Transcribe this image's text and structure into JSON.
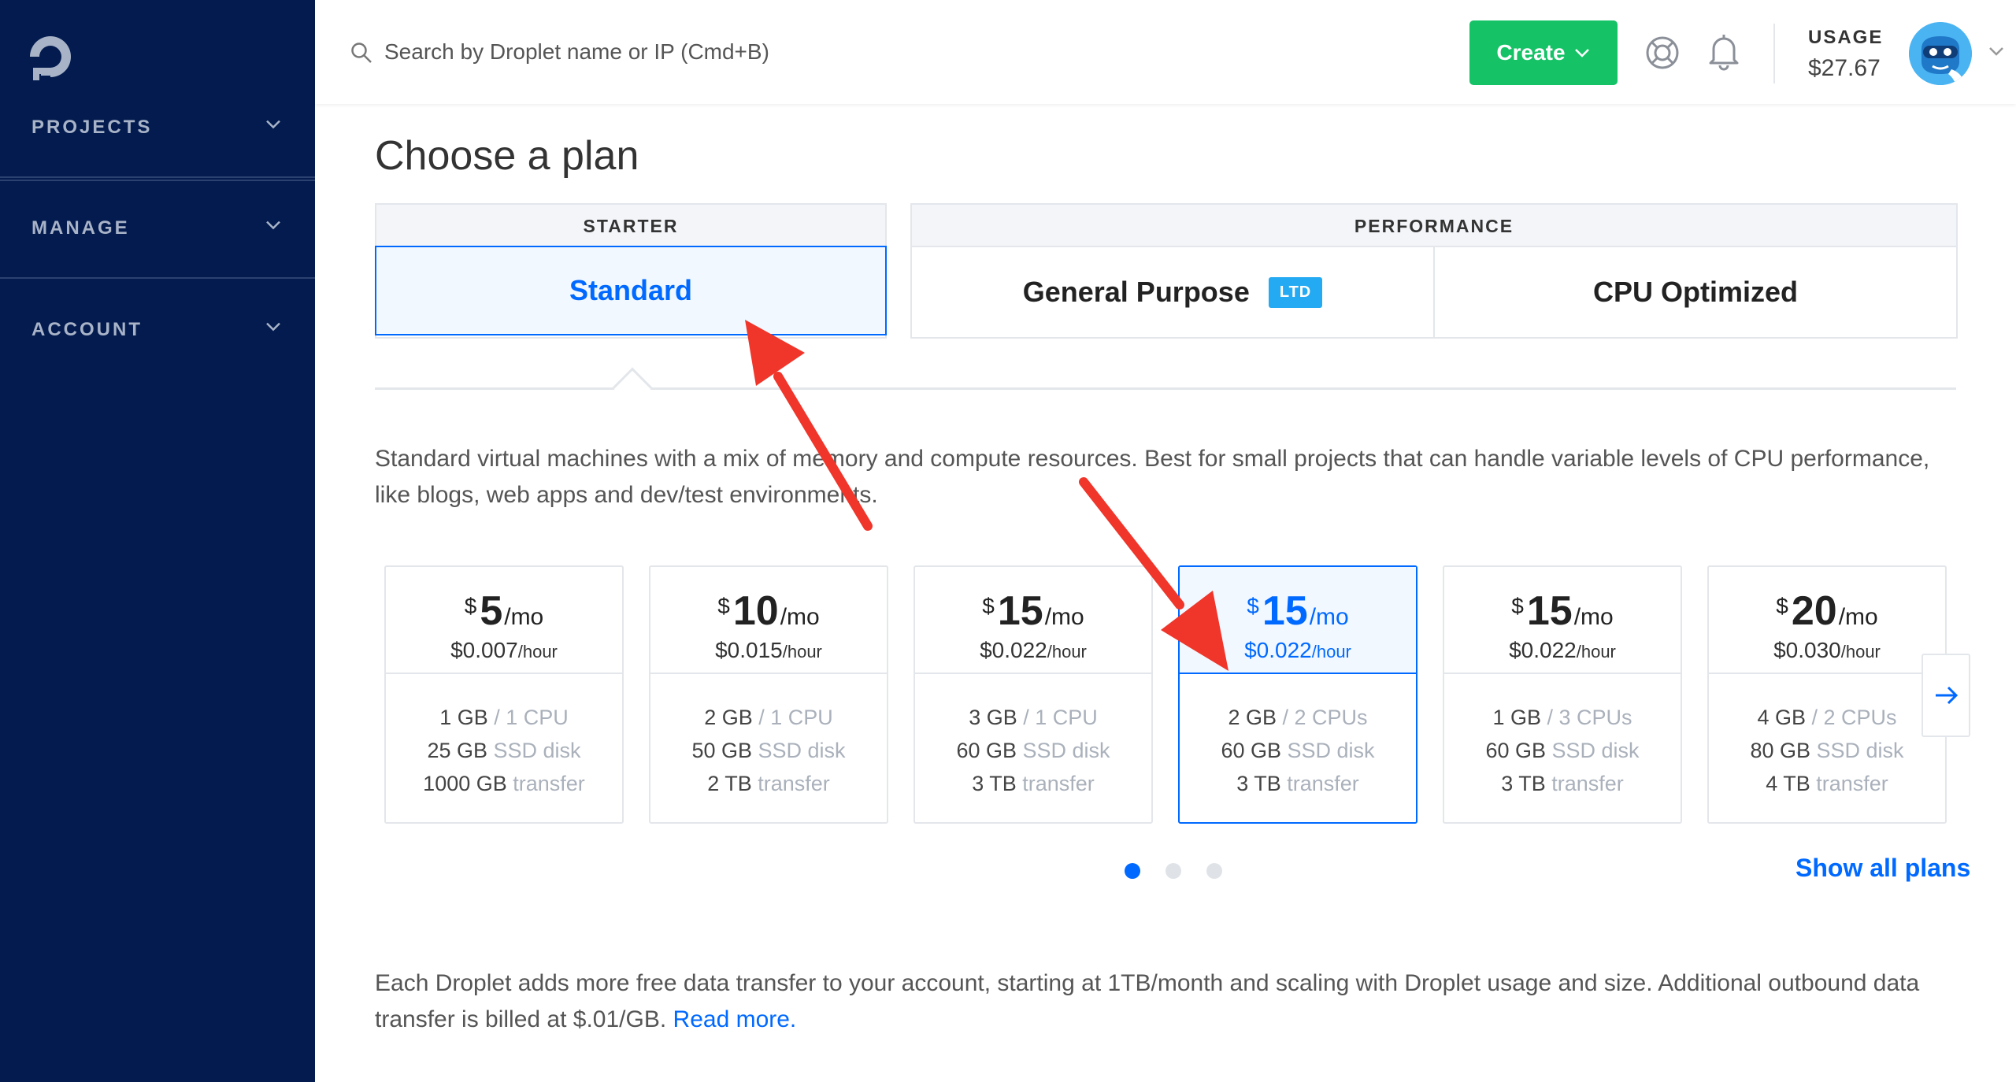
{
  "sidebar": {
    "items": [
      {
        "label": "PROJECTS"
      },
      {
        "label": "MANAGE"
      },
      {
        "label": "ACCOUNT"
      }
    ]
  },
  "topbar": {
    "search_placeholder": "Search by Droplet name or IP (Cmd+B)",
    "create_label": "Create",
    "usage_label": "USAGE",
    "usage_value": "$27.67"
  },
  "main": {
    "title": "Choose a plan",
    "groups": [
      {
        "label": "STARTER",
        "tabs": [
          {
            "label": "Standard",
            "selected": true
          }
        ]
      },
      {
        "label": "PERFORMANCE",
        "tabs": [
          {
            "label": "General Purpose",
            "badge": "LTD"
          },
          {
            "label": "CPU Optimized"
          }
        ]
      }
    ],
    "description": "Standard virtual machines with a mix of memory and compute resources. Best for small projects that can handle variable levels of CPU performance, like blogs, web apps and dev/test environments.",
    "plans": [
      {
        "currency": "$",
        "amount": "5",
        "per": "/mo",
        "hourly": "$0.007",
        "hourly_unit": "/hour",
        "ram": "1 GB",
        "cpu": "/ 1 CPU",
        "disk": "25 GB",
        "disk_label": "SSD disk",
        "transfer": "1000 GB",
        "transfer_label": "transfer"
      },
      {
        "currency": "$",
        "amount": "10",
        "per": "/mo",
        "hourly": "$0.015",
        "hourly_unit": "/hour",
        "ram": "2 GB",
        "cpu": "/ 1 CPU",
        "disk": "50 GB",
        "disk_label": "SSD disk",
        "transfer": "2 TB",
        "transfer_label": "transfer"
      },
      {
        "currency": "$",
        "amount": "15",
        "per": "/mo",
        "hourly": "$0.022",
        "hourly_unit": "/hour",
        "ram": "3 GB",
        "cpu": "/ 1 CPU",
        "disk": "60 GB",
        "disk_label": "SSD disk",
        "transfer": "3 TB",
        "transfer_label": "transfer"
      },
      {
        "currency": "$",
        "amount": "15",
        "per": "/mo",
        "hourly": "$0.022",
        "hourly_unit": "/hour",
        "ram": "2 GB",
        "cpu": "/ 2 CPUs",
        "disk": "60 GB",
        "disk_label": "SSD disk",
        "transfer": "3 TB",
        "transfer_label": "transfer",
        "selected": true
      },
      {
        "currency": "$",
        "amount": "15",
        "per": "/mo",
        "hourly": "$0.022",
        "hourly_unit": "/hour",
        "ram": "1 GB",
        "cpu": "/ 3 CPUs",
        "disk": "60 GB",
        "disk_label": "SSD disk",
        "transfer": "3 TB",
        "transfer_label": "transfer"
      },
      {
        "currency": "$",
        "amount": "20",
        "per": "/mo",
        "hourly": "$0.030",
        "hourly_unit": "/hour",
        "ram": "4 GB",
        "cpu": "/ 2 CPUs",
        "disk": "80 GB",
        "disk_label": "SSD disk",
        "transfer": "4 TB",
        "transfer_label": "transfer"
      }
    ],
    "pagination": {
      "pages": 3,
      "current": 1
    },
    "show_all_label": "Show all plans",
    "footnote": "Each Droplet adds more free data transfer to your account, starting at 1TB/month and scaling with Droplet usage and size. Additional outbound data transfer is billed at $.01/GB.",
    "footnote_link": "Read more."
  },
  "colors": {
    "sidebar_bg": "#031b4e",
    "accent_blue": "#0069ff",
    "create_green": "#15c266",
    "ltd_badge": "#23aaf2",
    "annotation_red": "#f0352a"
  },
  "icons": [
    "logo-icon",
    "search-icon",
    "chevron-down-icon",
    "help-icon",
    "bell-icon",
    "avatar",
    "arrow-right-icon"
  ]
}
